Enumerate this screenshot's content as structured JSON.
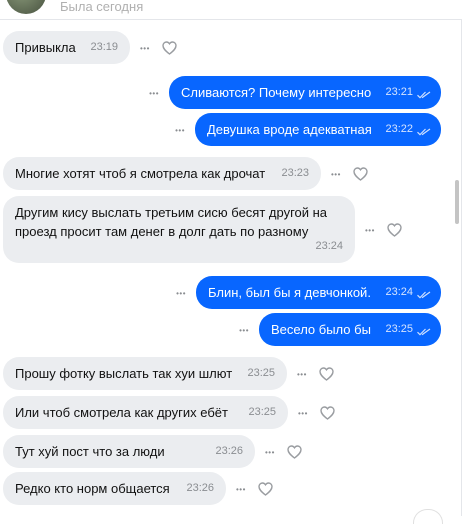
{
  "header": {
    "status": "Была сегодня"
  },
  "messages": [
    {
      "dir": "in",
      "text": "Привыкла",
      "time": "23:19"
    },
    {
      "dir": "out",
      "text": "Сливаются? Почему интересно",
      "time": "23:21"
    },
    {
      "dir": "out",
      "text": "Девушка вроде адекватная",
      "time": "23:22"
    },
    {
      "dir": "in",
      "text": "Многие хотят чтоб я смотрела как дрочат",
      "time": "23:23"
    },
    {
      "dir": "in",
      "text": "Другим кису выслать третьим сисю бесят другой на проезд просит там денег в долг дать по разному",
      "time": "23:24"
    },
    {
      "dir": "out",
      "text": "Блин, был бы я девчонкой.",
      "time": "23:24"
    },
    {
      "dir": "out",
      "text": "Весело было бы",
      "time": "23:25"
    },
    {
      "dir": "in",
      "text": "Прошу фотку выслать так хуи шлют",
      "time": "23:25"
    },
    {
      "dir": "in",
      "text": "Или чтоб смотрела как других ебёт",
      "time": "23:25"
    },
    {
      "dir": "in",
      "text": "Тут хуй пост что за люди",
      "time": "23:26"
    },
    {
      "dir": "in",
      "text": "Редко кто норм общается",
      "time": "23:26"
    }
  ],
  "icons": {
    "more": "more-dots-icon",
    "like": "heart-icon",
    "read": "double-check-icon"
  },
  "colors": {
    "outgoing": "#0866ff",
    "incoming": "#ebedf0"
  }
}
